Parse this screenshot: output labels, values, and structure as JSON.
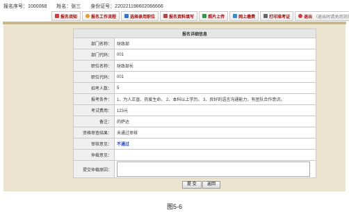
{
  "topinfo": {
    "signup_no": "报名序号：1000068",
    "name": "姓名：张三",
    "id_no": "身份证号：220221198602066666"
  },
  "toolbar": {
    "items": [
      {
        "label": "报名须知",
        "icon": "info-icon",
        "color": "#d83a3a"
      },
      {
        "label": "报名工作流程",
        "icon": "flow-icon",
        "color": "#e0a020"
      },
      {
        "label": "选择录用职位",
        "icon": "position-icon",
        "color": "#3a6fd8"
      },
      {
        "label": "报名资料填写",
        "icon": "form-icon",
        "color": "#c04040"
      },
      {
        "label": "照片上传",
        "icon": "photo-icon",
        "color": "#2e9a4a"
      },
      {
        "label": "网上缴费",
        "icon": "payment-icon",
        "color": "#3a8ad8"
      },
      {
        "label": "打印准考证",
        "icon": "printer-icon",
        "color": "#666666"
      },
      {
        "label": "退出",
        "icon": "exit-icon",
        "color": "#d83a3a"
      }
    ],
    "exit_note": "（退出时请关闭浏览器）"
  },
  "detail": {
    "title": "报名详细信息",
    "rows": [
      {
        "label": "部门名称：",
        "value": "财政部"
      },
      {
        "label": "部门代码：",
        "value": "001"
      },
      {
        "label": "职位名称：",
        "value": "财政部长"
      },
      {
        "label": "职位代码：",
        "value": "001"
      },
      {
        "label": "招考人数：",
        "value": "5"
      },
      {
        "label": "报考条件：",
        "value": "1、为人正直、热爱生命。 2、本科以上学历。 3、良好的语言沟通能力，有团队合作意识。"
      },
      {
        "label": "考试费用：",
        "value": "123元"
      },
      {
        "label": "备注：",
        "value": "的萨达"
      },
      {
        "label": "资格审查结果：",
        "value": "未通过审核"
      },
      {
        "label": "审核意见：",
        "value": "不通过"
      },
      {
        "label": "仲裁意见：",
        "value": ""
      }
    ],
    "appeal_label": "提交仲裁原因：",
    "appeal_value": ""
  },
  "buttons": {
    "submit": "提 交",
    "back": "返回"
  },
  "caption": "图5-6"
}
